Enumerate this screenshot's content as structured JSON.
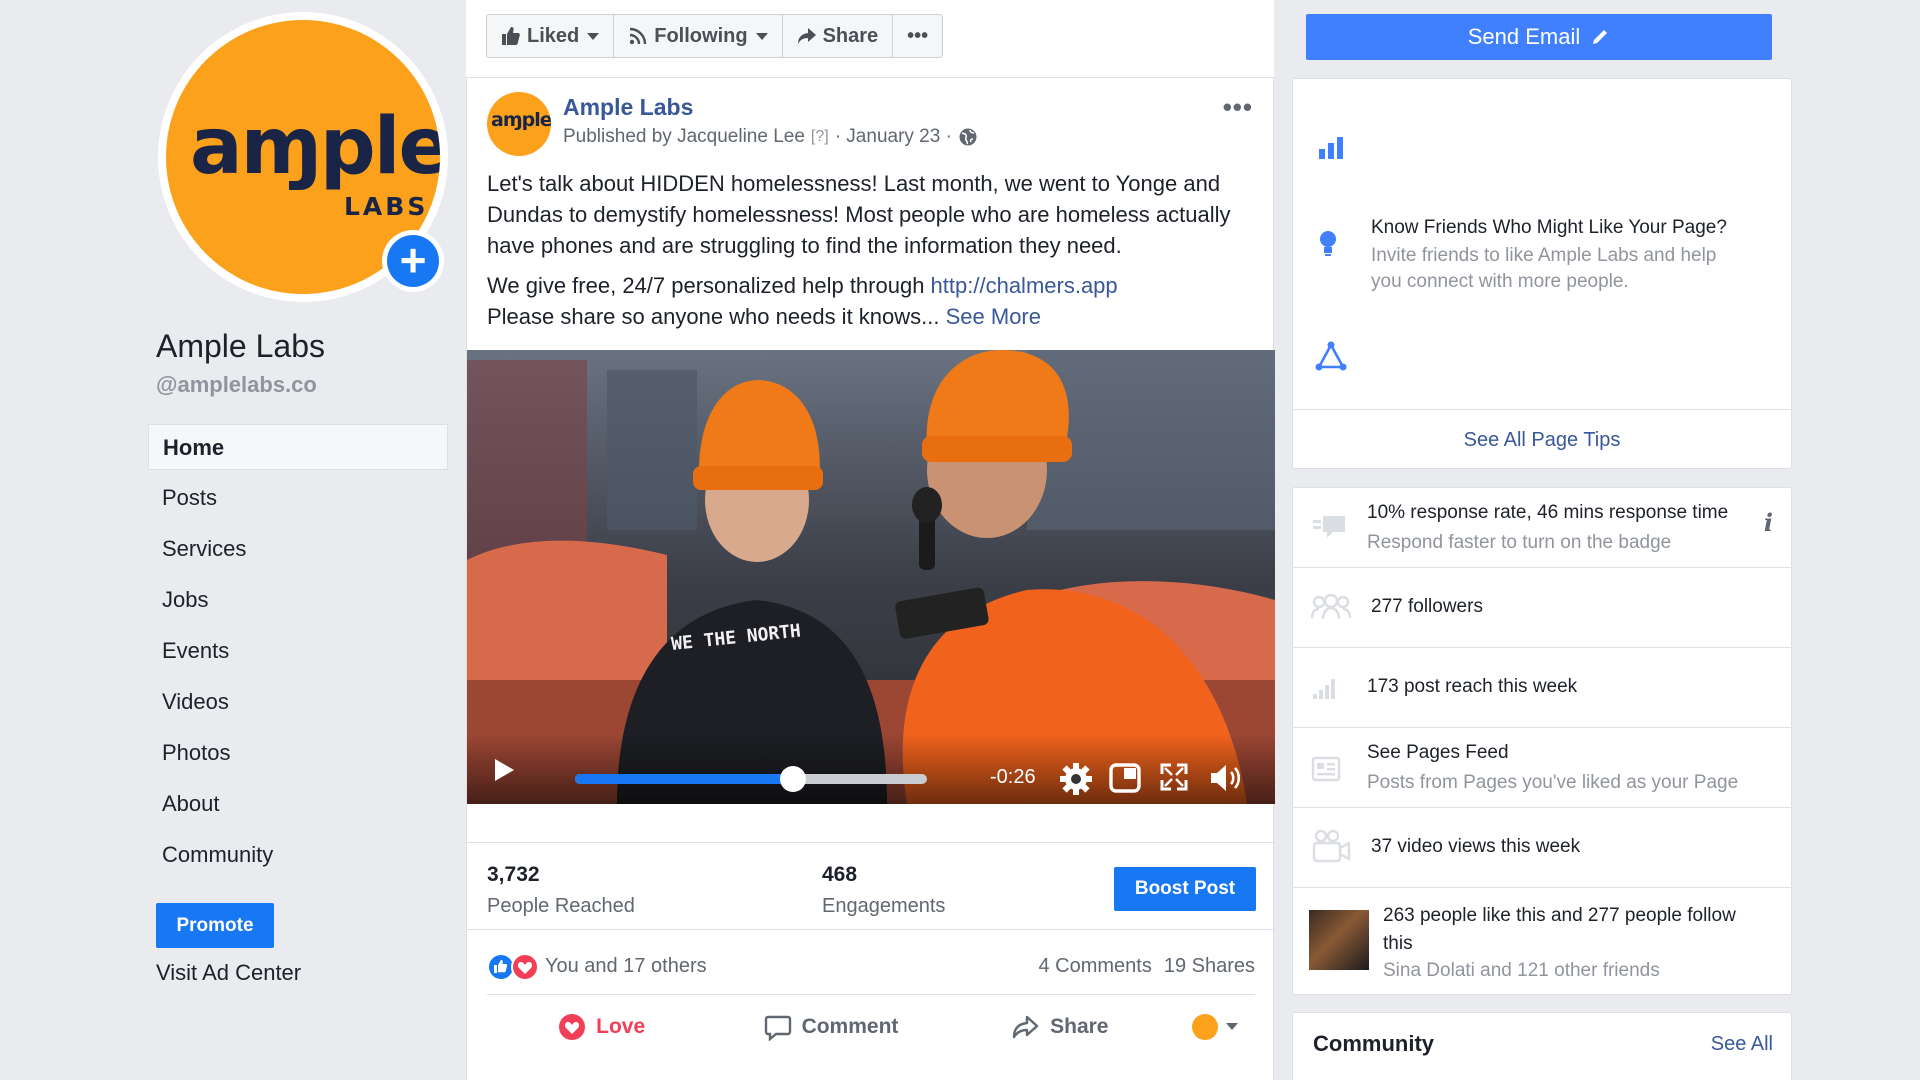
{
  "left": {
    "logo_main": "aɱple",
    "logo_sub": "LABS",
    "page_name": "Ample Labs",
    "handle": "@amplelabs.co",
    "nav": [
      "Home",
      "Posts",
      "Services",
      "Jobs",
      "Events",
      "Videos",
      "Photos",
      "About",
      "Community"
    ],
    "promote": "Promote",
    "ad_center": "Visit Ad Center"
  },
  "toolbar": {
    "liked": "Liked",
    "following": "Following",
    "share": "Share",
    "more": "•••"
  },
  "post": {
    "avatar_text": "aɱple",
    "author": "Ample Labs",
    "published_by": "Published by Jacqueline Lee",
    "help": "[?]",
    "date": "· January 23 ·",
    "more": "•••",
    "text1": "Let's talk about HIDDEN homelessness! Last month, we went to Yonge and Dundas to demystify homelessness! Most people who are homeless actually have phones and are struggling to find the information they need.",
    "text2_prefix": "We give free, 24/7 personalized help through ",
    "text2_link": "http://chalmers.app",
    "text3_prefix": "Please share so anyone who needs it knows... ",
    "see_more": "See More",
    "video": {
      "time_remaining": "-0:26",
      "progress": 0.62,
      "shirt_text": "WE THE NORTH"
    },
    "reached": "3,732",
    "reached_label": "People Reached",
    "engagements": "468",
    "engagements_label": "Engagements",
    "boost": "Boost Post",
    "reactions_text": "You and 17 others",
    "comments": "4 Comments",
    "shares": "19 Shares",
    "love": "Love",
    "comment": "Comment",
    "share": "Share"
  },
  "right": {
    "send_email": "Send Email",
    "tip_title": "Know Friends Who Might Like Your Page?",
    "tip_desc": "Invite friends to like Ample Labs and help you connect with more people.",
    "see_all_tips": "See All Page Tips",
    "response_main": "10% response rate, 46 mins response time",
    "response_sub": "Respond faster to turn on the badge",
    "info": "i",
    "followers": "277 followers",
    "reach": "173 post reach this week",
    "feed_main": "See Pages Feed",
    "feed_sub": "Posts from Pages you've liked as your Page",
    "video_views": "37 video views this week",
    "likes_main": "263 people like this and 277 people follow this",
    "likes_sub": "Sina Dolati and 121 other friends",
    "community": "Community",
    "see_all": "See All"
  },
  "colors": {
    "brand_orange": "#fca11c",
    "fb_blue": "#1877f2",
    "link_blue": "#385898",
    "love_red": "#f33e58"
  }
}
